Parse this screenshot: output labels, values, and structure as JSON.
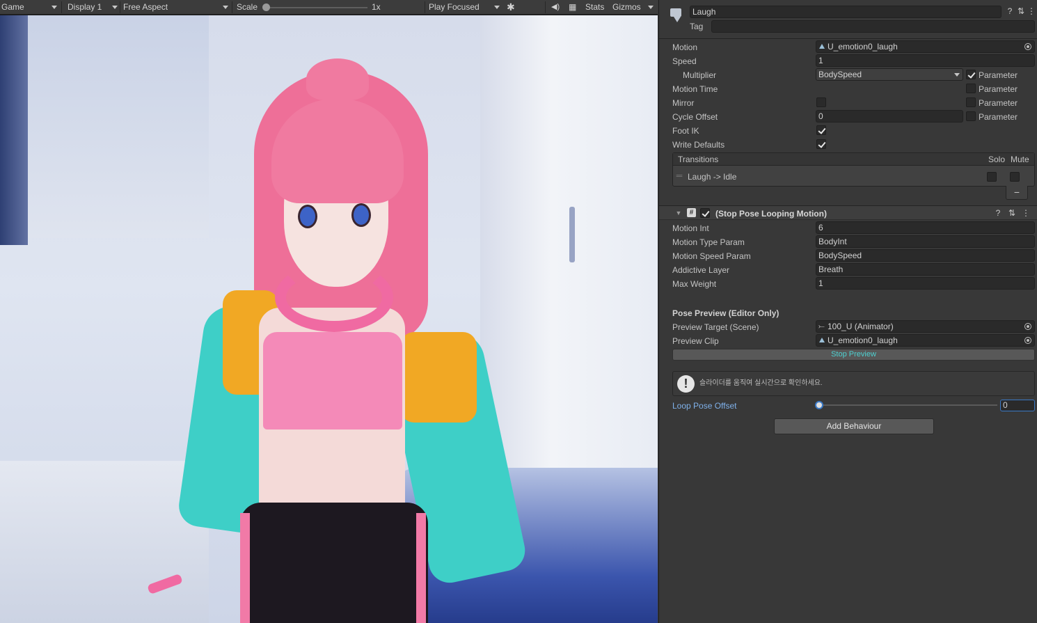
{
  "toolbar": {
    "view": "Game",
    "display": "Display 1",
    "aspect": "Free Aspect",
    "scale_label": "Scale",
    "scale_value": "1x",
    "play_mode": "Play Focused",
    "stats": "Stats",
    "gizmos": "Gizmos"
  },
  "state": {
    "name": "Laugh",
    "tag_label": "Tag",
    "tag_value": "",
    "motion": {
      "label": "Motion",
      "value": "U_emotion0_laugh"
    },
    "speed": {
      "label": "Speed",
      "value": "1"
    },
    "multiplier": {
      "label": "Multiplier",
      "value": "BodySpeed",
      "param_label": "Parameter",
      "param_checked": true
    },
    "motion_time": {
      "label": "Motion Time",
      "param_label": "Parameter",
      "param_checked": false
    },
    "mirror": {
      "label": "Mirror",
      "checked": false,
      "param_label": "Parameter",
      "param_checked": false
    },
    "cycle_offset": {
      "label": "Cycle Offset",
      "value": "0",
      "param_label": "Parameter",
      "param_checked": false
    },
    "foot_ik": {
      "label": "Foot IK",
      "checked": true
    },
    "write_defaults": {
      "label": "Write Defaults",
      "checked": true
    }
  },
  "transitions": {
    "title": "Transitions",
    "solo": "Solo",
    "mute": "Mute",
    "items": [
      {
        "label": "Laugh -> Idle",
        "solo": false,
        "mute": false
      }
    ],
    "remove_label": "−"
  },
  "component": {
    "title": "(Stop Pose Looping Motion)",
    "enabled": true,
    "fields": [
      {
        "label": "Motion Int",
        "value": "6"
      },
      {
        "label": "Motion Type Param",
        "value": "BodyInt"
      },
      {
        "label": "Motion Speed Param",
        "value": "BodySpeed"
      },
      {
        "label": "Addictive Layer",
        "value": "Breath"
      },
      {
        "label": "Max Weight",
        "value": "1"
      }
    ],
    "preview": {
      "header": "Pose Preview (Editor Only)",
      "target_label": "Preview Target (Scene)",
      "target_value": "100_U (Animator)",
      "clip_label": "Preview Clip",
      "clip_value": "U_emotion0_laugh",
      "stop_button": "Stop Preview",
      "help_text": "슬라이더를 움직여 실시간으로 확인하세요.",
      "loop_offset_label": "Loop Pose Offset",
      "loop_offset_value": "0",
      "loop_offset_fraction": 0
    }
  },
  "add_behaviour": "Add Behaviour",
  "colors": {
    "accent": "#3a79c6",
    "hair": "#f07aa0",
    "jacket": "#3ecfc7",
    "jacket_trim": "#f1a824",
    "top": "#f48ab8"
  }
}
